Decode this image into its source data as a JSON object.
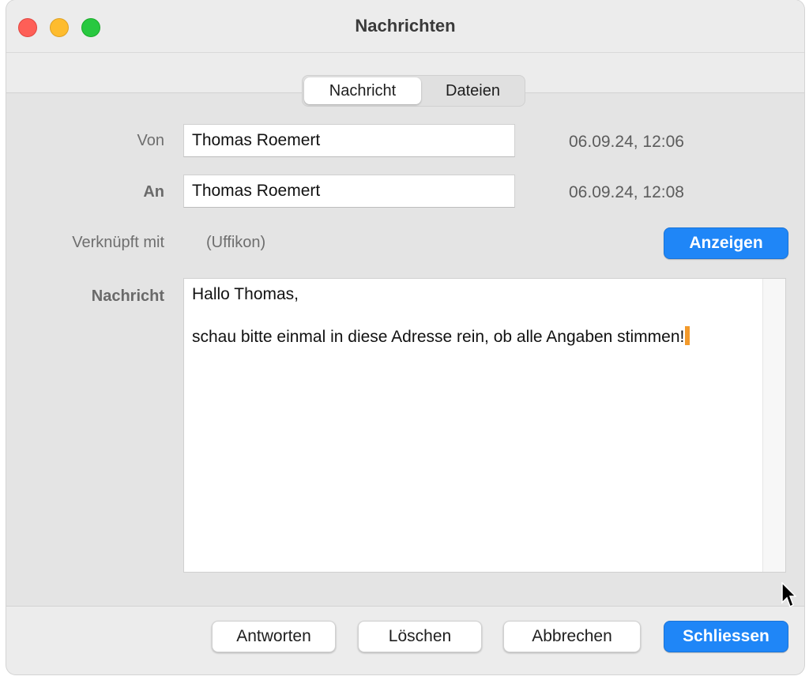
{
  "window": {
    "title": "Nachrichten"
  },
  "tabs": [
    {
      "label": "Nachricht",
      "active": true
    },
    {
      "label": "Dateien",
      "active": false
    }
  ],
  "form": {
    "from_label": "Von",
    "from_value": "Thomas Roemert",
    "from_date": "06.09.24, 12:06",
    "to_label": "An",
    "to_value": "Thomas Roemert",
    "to_date": "06.09.24, 12:08",
    "linked_label": "Verknüpft mit",
    "linked_value": "(Uffikon)",
    "show_button": "Anzeigen",
    "message_label": "Nachricht",
    "message_line1": "Hallo Thomas,",
    "message_line2": "schau bitte einmal in diese Adresse rein, ob alle Angaben stimmen!"
  },
  "footer": {
    "reply": "Antworten",
    "delete": "Löschen",
    "cancel": "Abbrechen",
    "close": "Schliessen"
  },
  "colors": {
    "accent": "#1f86f7",
    "caret": "#f39a2b",
    "traffic_close": "#fe5f57",
    "traffic_minimize": "#febc2e",
    "traffic_maximize": "#28c840"
  },
  "icons": {
    "pointer": "mouse-pointer-icon"
  }
}
